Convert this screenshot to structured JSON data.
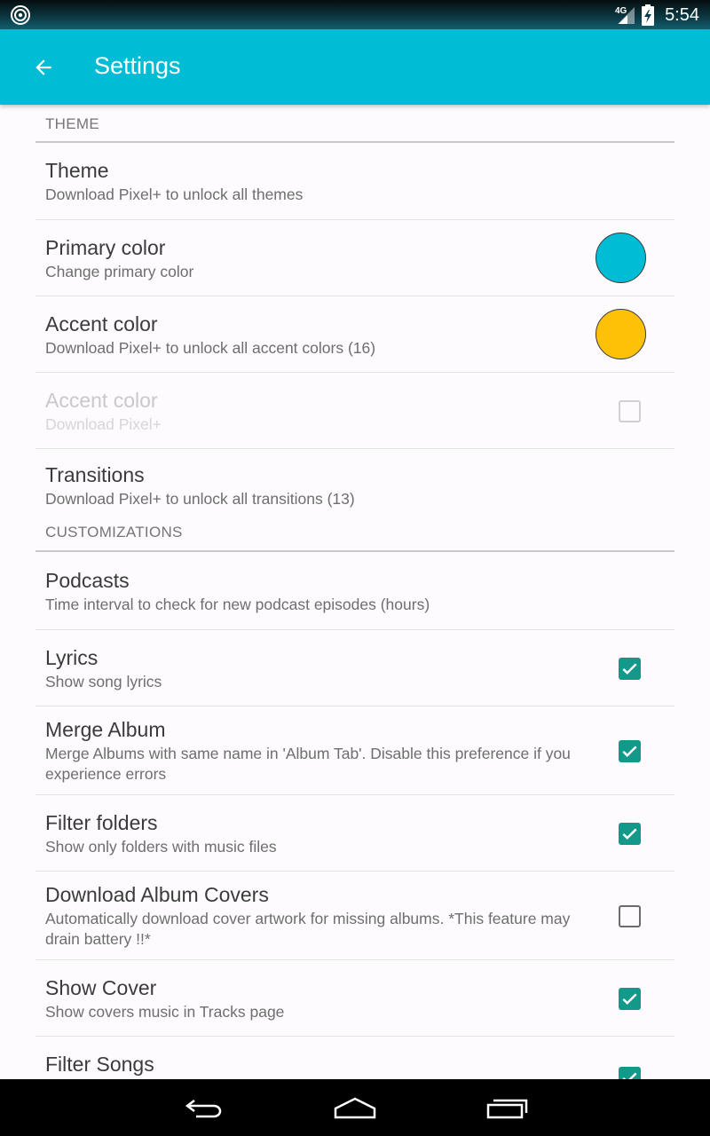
{
  "status_bar": {
    "time": "5:54",
    "network": "4G",
    "app_icon": "music-app-icon",
    "icons": [
      "signal-icon",
      "battery-charging-icon"
    ]
  },
  "toolbar": {
    "back_icon": "arrow-back-icon",
    "title": "Settings",
    "color": "#00bcd4"
  },
  "sections": {
    "theme": {
      "header": "THEME",
      "items": [
        {
          "title": "Theme",
          "summary": "Download Pixel+ to unlock all themes"
        },
        {
          "title": "Primary color",
          "summary": "Change primary color",
          "swatch": "#00bcd4"
        },
        {
          "title": "Accent color",
          "summary": "Download Pixel+ to unlock all accent colors (16)",
          "swatch": "#ffc107"
        },
        {
          "title": "Accent color",
          "summary": "Download Pixel+",
          "checked": false,
          "enabled": false
        },
        {
          "title": "Transitions",
          "summary": "Download Pixel+ to unlock all transitions (13)"
        }
      ]
    },
    "customizations": {
      "header": "CUSTOMIZATIONS",
      "items": [
        {
          "title": "Podcasts",
          "summary": "Time interval to check for new podcast episodes (hours)"
        },
        {
          "title": "Lyrics",
          "summary": "Show song lyrics",
          "checked": true
        },
        {
          "title": "Merge Album",
          "summary": "Merge Albums with same name in 'Album Tab'. Disable this preference if you experience errors",
          "checked": true
        },
        {
          "title": "Filter folders",
          "summary": "Show only folders with music files",
          "checked": true
        },
        {
          "title": "Download Album Covers",
          "summary": "Automatically download cover artwork for missing albums. *This feature may drain battery !!*",
          "checked": false
        },
        {
          "title": "Show Cover",
          "summary": "Show covers music in Tracks page",
          "checked": true
        },
        {
          "title": "Filter Songs",
          "summary": "",
          "checked": true
        }
      ]
    }
  },
  "colors": {
    "checkbox_checked": "#14988a",
    "primary": "#00bcd4",
    "accent": "#ffc107"
  },
  "nav_bar": {
    "icons": [
      "back-nav-icon",
      "home-nav-icon",
      "recents-nav-icon"
    ]
  }
}
